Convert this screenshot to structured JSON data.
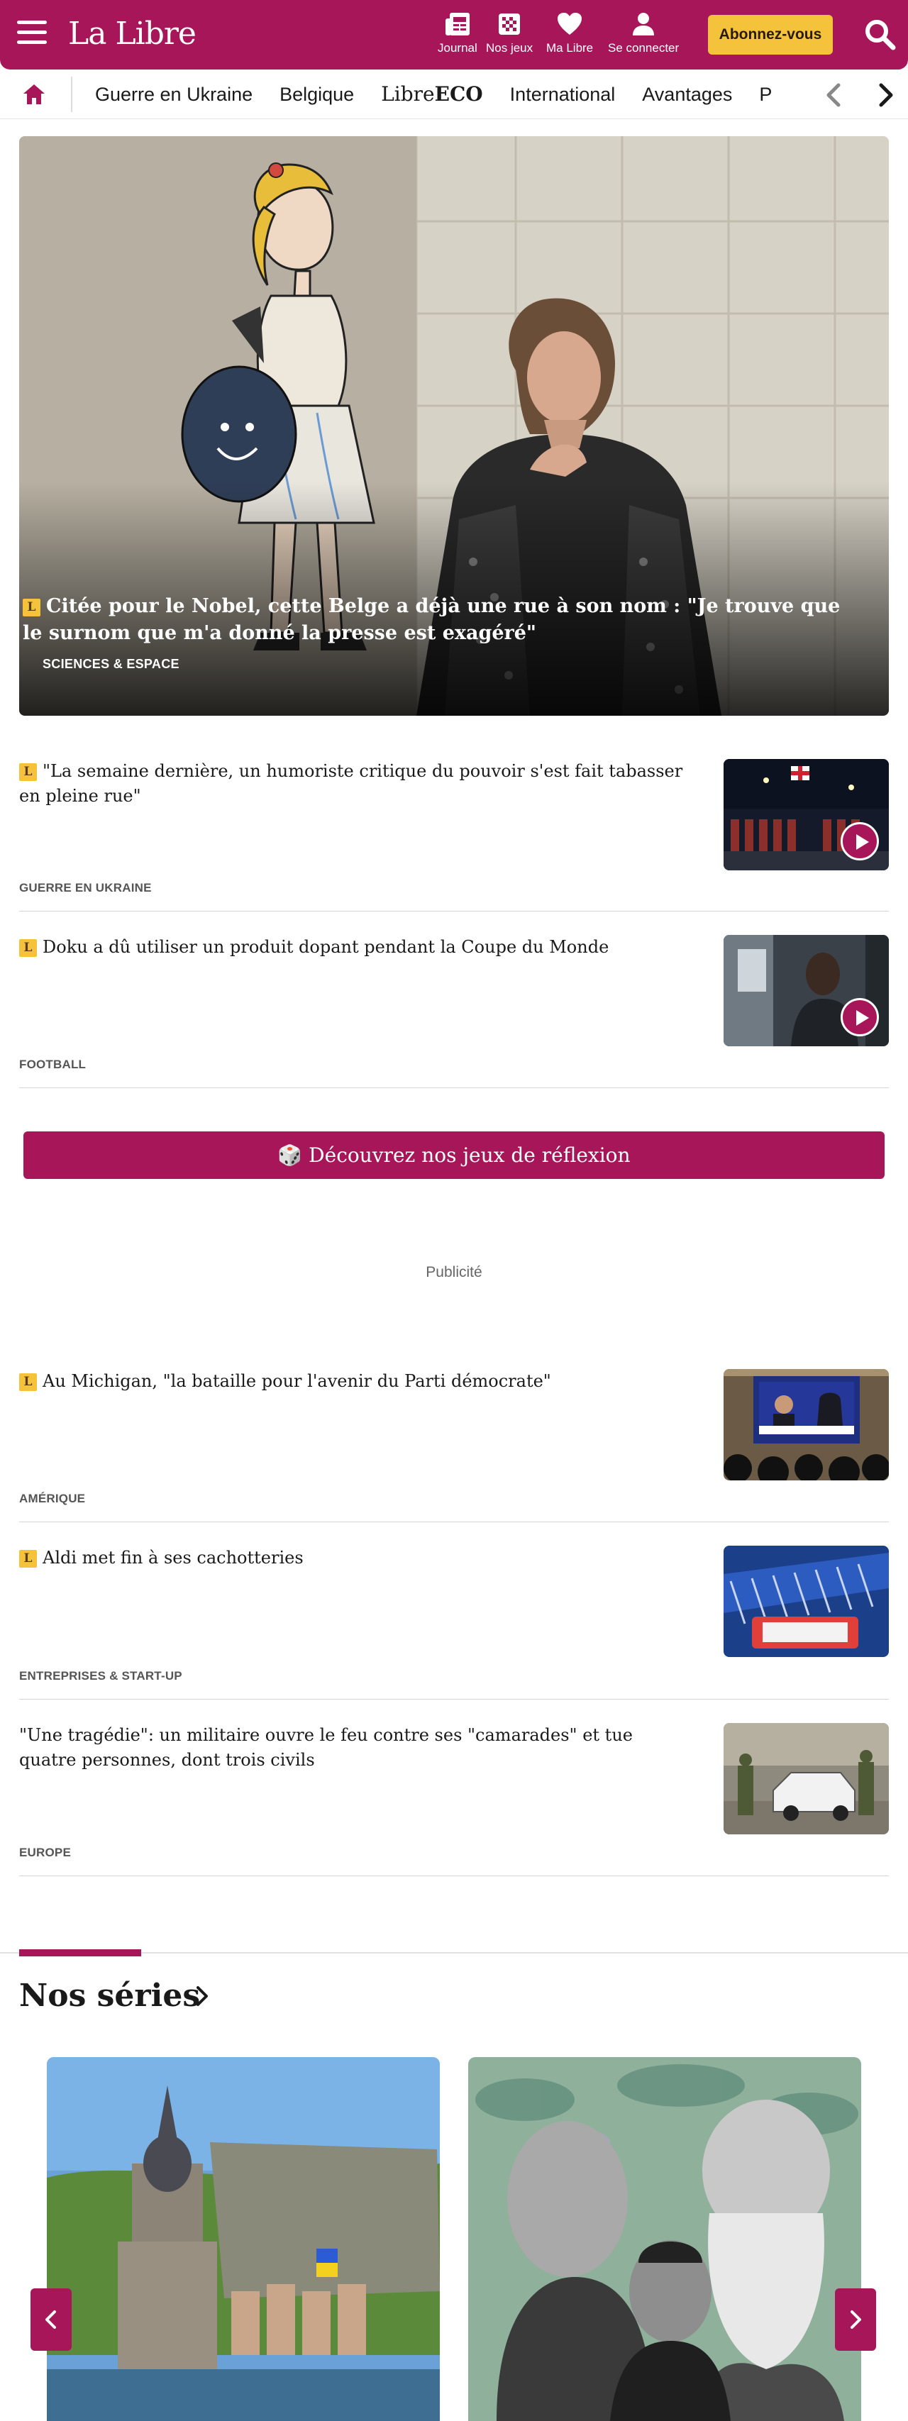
{
  "header": {
    "logo": "La Libre",
    "tools": [
      {
        "label": "Journal",
        "icon": "newspaper-icon"
      },
      {
        "label": "Nos jeux",
        "icon": "games-grid-icon"
      },
      {
        "label": "Ma Libre",
        "icon": "heart-icon"
      },
      {
        "label": "Se connecter",
        "icon": "user-icon"
      }
    ],
    "subscribe_label": "Abonnez-vous"
  },
  "nav": {
    "items": [
      "Guerre en Ukraine",
      "Belgique",
      "International",
      "Avantages",
      "P"
    ],
    "eco_prefix": "Libre",
    "eco_suffix": "ECO"
  },
  "hero": {
    "title": "Citée pour le Nobel, cette Belge a déjà une rue à son nom : \"Je trouve que le surnom que m'a donné la presse est exagéré\"",
    "tag": "SCIENCES & ESPACE",
    "badge": "L"
  },
  "articles": [
    {
      "badge": "L",
      "title": "\"La semaine dernière, un humoriste critique du pouvoir s'est fait tabasser en pleine rue\"",
      "tag": "GUERRE EN UKRAINE",
      "video": true
    },
    {
      "badge": "L",
      "title": "Doku a dû utiliser un produit dopant pendant la Coupe du Monde",
      "tag": "FOOTBALL",
      "video": true
    }
  ],
  "games_button": "🎲 Découvrez nos jeux de réflexion",
  "ad_label": "Publicité",
  "articles2": [
    {
      "badge": "L",
      "title": "Au Michigan, \"la bataille pour l'avenir du Parti démocrate\"",
      "tag": "AMÉRIQUE"
    },
    {
      "badge": "L",
      "title": "Aldi met fin à ses cachotteries",
      "tag": "ENTREPRISES & START-UP"
    },
    {
      "badge": "",
      "title": "\"Une tragédie\": un militaire ouvre le feu contre ses \"camarades\" et tue quatre personnes, dont trois civils",
      "tag": "EUROPE"
    }
  ],
  "series": {
    "title": "Nos séries"
  },
  "colors": {
    "brand": "#a8165a",
    "accent": "#f5c33b"
  }
}
